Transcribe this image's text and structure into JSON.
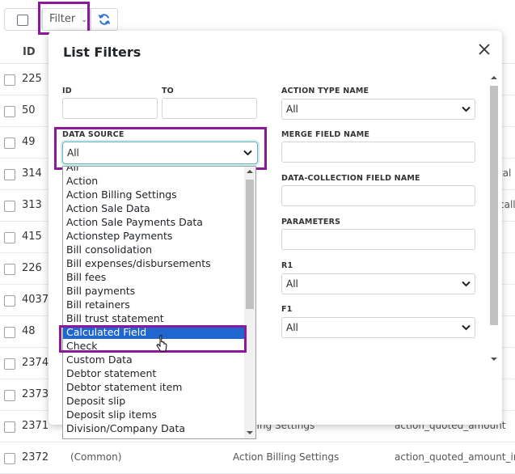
{
  "toolbar": {
    "filter_label": "Filter"
  },
  "table": {
    "id_header": "ID",
    "rows": [
      {
        "id": "225",
        "c1": "",
        "c2": "",
        "c3": "",
        "right": ""
      },
      {
        "id": "50",
        "c1": "",
        "c2": "",
        "c3": "",
        "right": ""
      },
      {
        "id": "49",
        "c1": "",
        "c2": "",
        "c3": "",
        "right": ""
      },
      {
        "id": "314",
        "c1": "",
        "c2": "",
        "c3": "",
        "right": "tal"
      },
      {
        "id": "313",
        "c1": "",
        "c2": "",
        "c3": "",
        "right": "call"
      },
      {
        "id": "415",
        "c1": "",
        "c2": "",
        "c3": "",
        "right": ""
      },
      {
        "id": "226",
        "c1": "",
        "c2": "",
        "c3": "",
        "right": ""
      },
      {
        "id": "4037",
        "c1": "",
        "c2": "",
        "c3": "",
        "right": ""
      },
      {
        "id": "48",
        "c1": "",
        "c2": "",
        "c3": "",
        "right": ""
      },
      {
        "id": "2374",
        "c1": "",
        "c2": "",
        "c3": "",
        "right": ""
      },
      {
        "id": "2373",
        "c1": "",
        "c2": "",
        "c3": "",
        "right": ""
      },
      {
        "id": "2371",
        "c1": "",
        "c2": "n Billing Settings",
        "c3": "action_quoted_amount",
        "right": ""
      },
      {
        "id": "2372",
        "c1": "(Common)",
        "c2": "Action Billing Settings",
        "c3": "action_quoted_amount_inc",
        "right": ""
      }
    ]
  },
  "modal": {
    "title": "List Filters",
    "id_label": "ID",
    "to_label": "TO",
    "data_source_label": "DATA SOURCE",
    "data_source_value": "All",
    "action_type_label": "ACTION TYPE NAME",
    "action_type_value": "All",
    "merge_field_label": "MERGE FIELD NAME",
    "dc_field_label": "DATA-COLLECTION FIELD NAME",
    "parameters_label": "PARAMETERS",
    "r1_label": "R1",
    "r1_value": "All",
    "f1_label": "F1",
    "f1_value": "All"
  },
  "data_source_options": [
    "All",
    "Action",
    "Action Billing Settings",
    "Action Sale Data",
    "Action Sale Payments Data",
    "Actionstep Payments",
    "Bill consolidation",
    "Bill expenses/disbursements",
    "Bill fees",
    "Bill payments",
    "Bill retainers",
    "Bill trust statement",
    "Calculated Field",
    "Check",
    "Custom Data",
    "Debtor statement",
    "Debtor statement item",
    "Deposit slip",
    "Deposit slip items",
    "Division/Company Data"
  ],
  "selected_option": "Calculated Field",
  "colors": {
    "highlight": "#8b1a9b",
    "selection": "#1f66d1",
    "focus": "#6bb5b8"
  }
}
